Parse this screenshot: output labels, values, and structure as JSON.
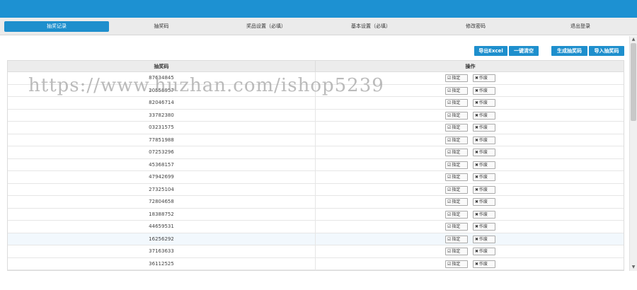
{
  "nav": {
    "items": [
      {
        "label": "抽奖记录",
        "active": true
      },
      {
        "label": "抽奖码",
        "active": false
      },
      {
        "label": "奖品设置（必填）",
        "active": false
      },
      {
        "label": "基本设置（必填）",
        "active": false
      },
      {
        "label": "修改密码",
        "active": false
      },
      {
        "label": "退出登录",
        "active": false
      }
    ]
  },
  "toolbar": {
    "export_excel": "导出Excel",
    "clear_all": "一键清空",
    "generate_codes": "生成抽奖码",
    "import_codes": "导入抽奖码"
  },
  "table": {
    "headers": [
      "抽奖码",
      "操作"
    ],
    "assign_label": "指定",
    "void_label": "作废",
    "rows": [
      "87634845",
      "20558957",
      "82046714",
      "33782380",
      "03231575",
      "77851988",
      "07253296",
      "45368157",
      "47942699",
      "27325104",
      "72804658",
      "18388752",
      "44659531",
      "16256292",
      "37163633",
      "36112525"
    ]
  },
  "watermark": "https://www.huzhan.com/ishop5239",
  "colors": {
    "accent": "#1e8fcd",
    "topbar": "#1d91d2",
    "row_highlight": "#f2f8fd"
  },
  "icons": {
    "assign": "edit-check-icon",
    "void": "x-icon"
  }
}
